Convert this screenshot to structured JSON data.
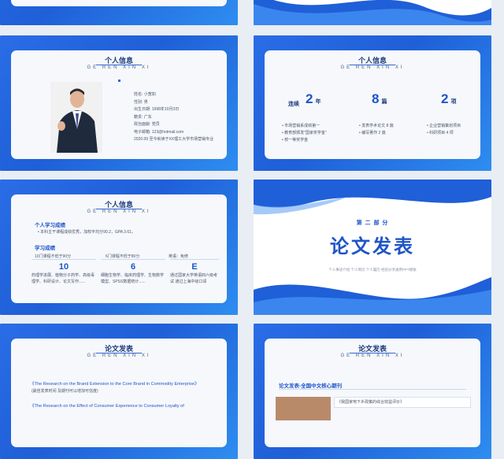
{
  "slide3": {
    "title": "个人信息",
    "subtitle": "GE REN XIN XI",
    "fields": [
      {
        "label": "姓名:",
        "value": "小宽如"
      },
      {
        "label": "性别:",
        "value": "男"
      },
      {
        "label": "出生日期:",
        "value": "1998年10月3日"
      },
      {
        "label": "籍贯:",
        "value": "广东"
      },
      {
        "label": "政治面貌:",
        "value": "党员"
      },
      {
        "label": "电子邮箱:",
        "value": "123@hotmail.com"
      }
    ],
    "education": "2020.09 至今就读于XX理工大学市场营销专业"
  },
  "slide4": {
    "title": "个人信息",
    "subtitle": "GE REN XIN XI",
    "prefix": "连续",
    "stats": [
      {
        "value": "2",
        "unit": "年",
        "items": [
          "市场营销系成绩第一",
          "教育部颁发\"国家奖学金\"",
          "校一等奖学金"
        ]
      },
      {
        "value": "8",
        "unit": "篇",
        "items": [
          "发表学术论文 8 篇",
          "编写著作 2 篇"
        ]
      },
      {
        "value": "2",
        "unit": "项",
        "items": [
          "企业营销策划项目",
          "科研项目 4 项"
        ]
      }
    ]
  },
  "slide5": {
    "title": "个人信息",
    "subtitle": "GE REN XIN XI",
    "section1": "个人学习成绩",
    "bullet1": "本科主干课程成绩优秀，加权平均分90.2，GPA 3.61。",
    "section2": "学习成绩",
    "cols": [
      {
        "head": "10门课程不低于90分",
        "num": "10",
        "desc": "药理学进展、植物分子药学、高级毒理学、科研设计、论文写作......"
      },
      {
        "head": "6门课程不低于80分",
        "num": "6",
        "desc": "细胞生物学、临床药理学、生物数学模型、SPSS数据统计......"
      },
      {
        "head": "英语：免修",
        "num": "E",
        "desc": "通过国家大学英语四六级考试 通过上海中级口译"
      }
    ]
  },
  "slide6": {
    "part": "第 二 部 分",
    "title": "论文发表",
    "caption": "个人事迹介绍 个人简历 个人履历 经验分享通用PPT模板"
  },
  "slide7": {
    "title": "论文发表",
    "subtitle": "GE REN XIN XI",
    "paper1": "《The Research on the Brand Extension to the Core Brand in Commodity Enterprise》",
    "paper1_note": "(最佳发表时间 及期刊可以增加可信度)",
    "paper2": "《The Research  on the Effect of Consumer Experience to Consumer Loyalty  of"
  },
  "slide8": {
    "title": "论文发表",
    "subtitle": "GE REN XIN XI",
    "heading": "论文发表-全国中文核心期刊",
    "paper": "《我国家电下乡政策的综合效益评价》"
  }
}
